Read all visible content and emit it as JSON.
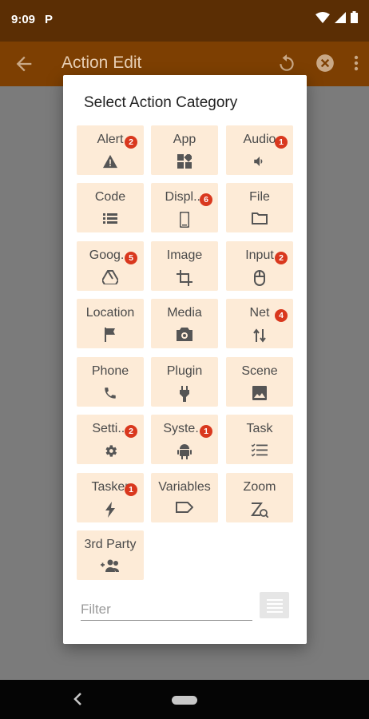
{
  "status_bar": {
    "time": "9:09",
    "notification_letter": "P"
  },
  "app_bar": {
    "title": "Action Edit"
  },
  "dialog": {
    "title": "Select Action Category",
    "categories": [
      {
        "label": "Alert",
        "icon": "warning-icon",
        "badge": "2"
      },
      {
        "label": "App",
        "icon": "apps-icon",
        "badge": ""
      },
      {
        "label": "Audio",
        "icon": "volume-icon",
        "badge": "1"
      },
      {
        "label": "Code",
        "icon": "list-icon",
        "badge": ""
      },
      {
        "label": "Displ...",
        "icon": "phone-device-icon",
        "badge": "6"
      },
      {
        "label": "File",
        "icon": "folder-icon",
        "badge": ""
      },
      {
        "label": "Goog...",
        "icon": "drive-icon",
        "badge": "5"
      },
      {
        "label": "Image",
        "icon": "crop-icon",
        "badge": ""
      },
      {
        "label": "Input",
        "icon": "mouse-icon",
        "badge": "2"
      },
      {
        "label": "Location",
        "icon": "flag-icon",
        "badge": ""
      },
      {
        "label": "Media",
        "icon": "camera-icon",
        "badge": ""
      },
      {
        "label": "Net",
        "icon": "swap-arrows-icon",
        "badge": "4"
      },
      {
        "label": "Phone",
        "icon": "phone-icon",
        "badge": ""
      },
      {
        "label": "Plugin",
        "icon": "plug-icon",
        "badge": ""
      },
      {
        "label": "Scene",
        "icon": "picture-icon",
        "badge": ""
      },
      {
        "label": "Setti...",
        "icon": "gear-icon",
        "badge": "2"
      },
      {
        "label": "Syste...",
        "icon": "android-icon",
        "badge": "1"
      },
      {
        "label": "Task",
        "icon": "checklist-icon",
        "badge": ""
      },
      {
        "label": "Tasker",
        "icon": "flash-icon",
        "badge": "1"
      },
      {
        "label": "Variables",
        "icon": "label-icon",
        "badge": ""
      },
      {
        "label": "Zoom",
        "icon": "zoom-icon",
        "badge": ""
      },
      {
        "label": "3rd Party",
        "icon": "group-add-icon",
        "badge": ""
      }
    ],
    "filter_placeholder": "Filter",
    "filter_value": ""
  },
  "colors": {
    "status_bar": "#5b2e04",
    "app_bar": "#7d3f02",
    "tile": "#fdebd7",
    "badge": "#d9381e"
  }
}
